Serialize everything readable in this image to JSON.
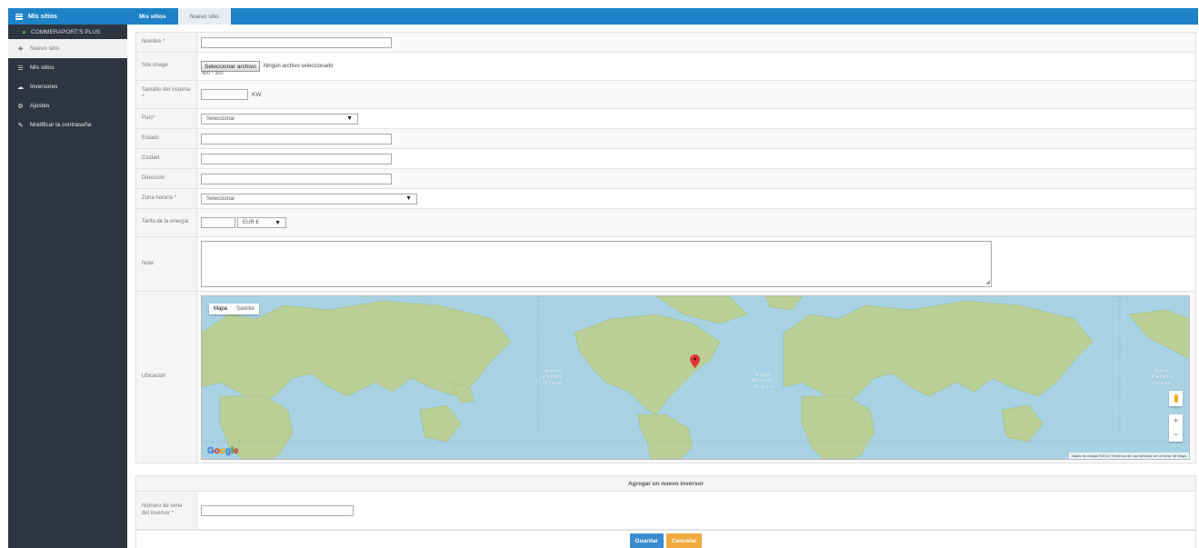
{
  "sidebar": {
    "header": "Mis sitios",
    "sub_item": "COMMERAPORT'S PLUS",
    "items": [
      {
        "label": "Nuevo sitio",
        "icon": "plus-icon"
      },
      {
        "label": "Mis sitios",
        "icon": "list-icon"
      },
      {
        "label": "Inversores",
        "icon": "cloud-icon"
      },
      {
        "label": "Ajustes",
        "icon": "gear-icon"
      },
      {
        "label": "Modificar la contraseña",
        "icon": "edit-icon"
      }
    ]
  },
  "tabs": [
    {
      "label": "Mis sitios",
      "active": false
    },
    {
      "label": "Nuevo sitio",
      "active": true
    }
  ],
  "form": {
    "name_label": "Nombre *",
    "image_label": "Site Image",
    "file_button": "Seleccionar archivo",
    "file_status": "Ningún archivo seleccionado",
    "image_hint": "400 * 300",
    "size_label": "Tamaño del sistema *",
    "size_unit": "KW",
    "country_label": "País*",
    "country_value": "Seleccionar",
    "state_label": "Estado",
    "city_label": "Ciudad",
    "address_label": "Dirección",
    "timezone_label": "Zona horaria *",
    "timezone_value": "Seleccionar",
    "tariff_label": "Tarifa de la energía",
    "currency_value": "EUR €",
    "note_label": "Nota",
    "location_label": "Ubicación"
  },
  "map": {
    "type_map": "Mapa",
    "type_satellite": "Satélite",
    "zoom_in": "+",
    "zoom_out": "−",
    "logo": "Google",
    "footer": "Datos de mapas ©2016   Términos de uso   Informar de un error de Maps",
    "labels": {
      "north_pacific_1": "North\nPacific\nOcean",
      "north_atlantic": "North\nAtlantic\nOcean",
      "north_pacific_2": "North\nPacific\nOcean"
    },
    "colors": {
      "water": "#a9d3e4",
      "land": "#b9cf96",
      "pin": "#e53935"
    }
  },
  "inverter_section": {
    "title": "Agregar un nuevo inversor",
    "serial_label": "Número de serie del inversor *"
  },
  "buttons": {
    "save": "Guardar",
    "cancel": "Cancelar"
  }
}
